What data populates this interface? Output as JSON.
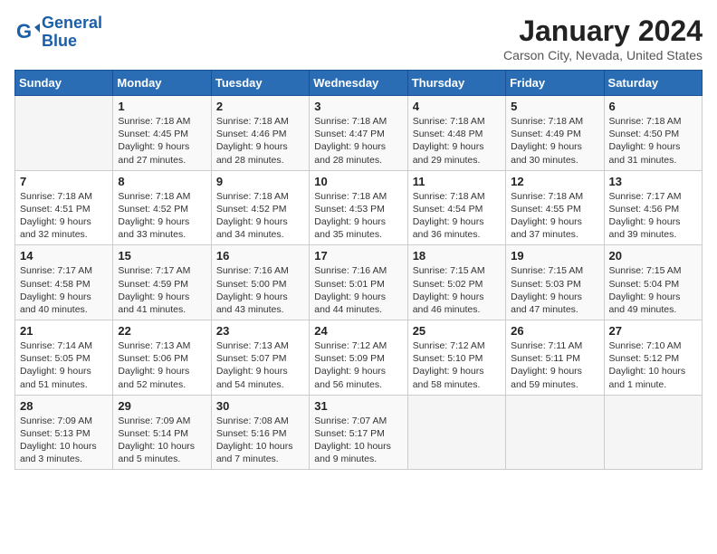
{
  "header": {
    "logo_line1": "General",
    "logo_line2": "Blue",
    "month": "January 2024",
    "location": "Carson City, Nevada, United States"
  },
  "days_of_week": [
    "Sunday",
    "Monday",
    "Tuesday",
    "Wednesday",
    "Thursday",
    "Friday",
    "Saturday"
  ],
  "weeks": [
    [
      {
        "num": "",
        "info": ""
      },
      {
        "num": "1",
        "info": "Sunrise: 7:18 AM\nSunset: 4:45 PM\nDaylight: 9 hours\nand 27 minutes."
      },
      {
        "num": "2",
        "info": "Sunrise: 7:18 AM\nSunset: 4:46 PM\nDaylight: 9 hours\nand 28 minutes."
      },
      {
        "num": "3",
        "info": "Sunrise: 7:18 AM\nSunset: 4:47 PM\nDaylight: 9 hours\nand 28 minutes."
      },
      {
        "num": "4",
        "info": "Sunrise: 7:18 AM\nSunset: 4:48 PM\nDaylight: 9 hours\nand 29 minutes."
      },
      {
        "num": "5",
        "info": "Sunrise: 7:18 AM\nSunset: 4:49 PM\nDaylight: 9 hours\nand 30 minutes."
      },
      {
        "num": "6",
        "info": "Sunrise: 7:18 AM\nSunset: 4:50 PM\nDaylight: 9 hours\nand 31 minutes."
      }
    ],
    [
      {
        "num": "7",
        "info": "Sunrise: 7:18 AM\nSunset: 4:51 PM\nDaylight: 9 hours\nand 32 minutes."
      },
      {
        "num": "8",
        "info": "Sunrise: 7:18 AM\nSunset: 4:52 PM\nDaylight: 9 hours\nand 33 minutes."
      },
      {
        "num": "9",
        "info": "Sunrise: 7:18 AM\nSunset: 4:52 PM\nDaylight: 9 hours\nand 34 minutes."
      },
      {
        "num": "10",
        "info": "Sunrise: 7:18 AM\nSunset: 4:53 PM\nDaylight: 9 hours\nand 35 minutes."
      },
      {
        "num": "11",
        "info": "Sunrise: 7:18 AM\nSunset: 4:54 PM\nDaylight: 9 hours\nand 36 minutes."
      },
      {
        "num": "12",
        "info": "Sunrise: 7:18 AM\nSunset: 4:55 PM\nDaylight: 9 hours\nand 37 minutes."
      },
      {
        "num": "13",
        "info": "Sunrise: 7:17 AM\nSunset: 4:56 PM\nDaylight: 9 hours\nand 39 minutes."
      }
    ],
    [
      {
        "num": "14",
        "info": "Sunrise: 7:17 AM\nSunset: 4:58 PM\nDaylight: 9 hours\nand 40 minutes."
      },
      {
        "num": "15",
        "info": "Sunrise: 7:17 AM\nSunset: 4:59 PM\nDaylight: 9 hours\nand 41 minutes."
      },
      {
        "num": "16",
        "info": "Sunrise: 7:16 AM\nSunset: 5:00 PM\nDaylight: 9 hours\nand 43 minutes."
      },
      {
        "num": "17",
        "info": "Sunrise: 7:16 AM\nSunset: 5:01 PM\nDaylight: 9 hours\nand 44 minutes."
      },
      {
        "num": "18",
        "info": "Sunrise: 7:15 AM\nSunset: 5:02 PM\nDaylight: 9 hours\nand 46 minutes."
      },
      {
        "num": "19",
        "info": "Sunrise: 7:15 AM\nSunset: 5:03 PM\nDaylight: 9 hours\nand 47 minutes."
      },
      {
        "num": "20",
        "info": "Sunrise: 7:15 AM\nSunset: 5:04 PM\nDaylight: 9 hours\nand 49 minutes."
      }
    ],
    [
      {
        "num": "21",
        "info": "Sunrise: 7:14 AM\nSunset: 5:05 PM\nDaylight: 9 hours\nand 51 minutes."
      },
      {
        "num": "22",
        "info": "Sunrise: 7:13 AM\nSunset: 5:06 PM\nDaylight: 9 hours\nand 52 minutes."
      },
      {
        "num": "23",
        "info": "Sunrise: 7:13 AM\nSunset: 5:07 PM\nDaylight: 9 hours\nand 54 minutes."
      },
      {
        "num": "24",
        "info": "Sunrise: 7:12 AM\nSunset: 5:09 PM\nDaylight: 9 hours\nand 56 minutes."
      },
      {
        "num": "25",
        "info": "Sunrise: 7:12 AM\nSunset: 5:10 PM\nDaylight: 9 hours\nand 58 minutes."
      },
      {
        "num": "26",
        "info": "Sunrise: 7:11 AM\nSunset: 5:11 PM\nDaylight: 9 hours\nand 59 minutes."
      },
      {
        "num": "27",
        "info": "Sunrise: 7:10 AM\nSunset: 5:12 PM\nDaylight: 10 hours\nand 1 minute."
      }
    ],
    [
      {
        "num": "28",
        "info": "Sunrise: 7:09 AM\nSunset: 5:13 PM\nDaylight: 10 hours\nand 3 minutes."
      },
      {
        "num": "29",
        "info": "Sunrise: 7:09 AM\nSunset: 5:14 PM\nDaylight: 10 hours\nand 5 minutes."
      },
      {
        "num": "30",
        "info": "Sunrise: 7:08 AM\nSunset: 5:16 PM\nDaylight: 10 hours\nand 7 minutes."
      },
      {
        "num": "31",
        "info": "Sunrise: 7:07 AM\nSunset: 5:17 PM\nDaylight: 10 hours\nand 9 minutes."
      },
      {
        "num": "",
        "info": ""
      },
      {
        "num": "",
        "info": ""
      },
      {
        "num": "",
        "info": ""
      }
    ]
  ]
}
